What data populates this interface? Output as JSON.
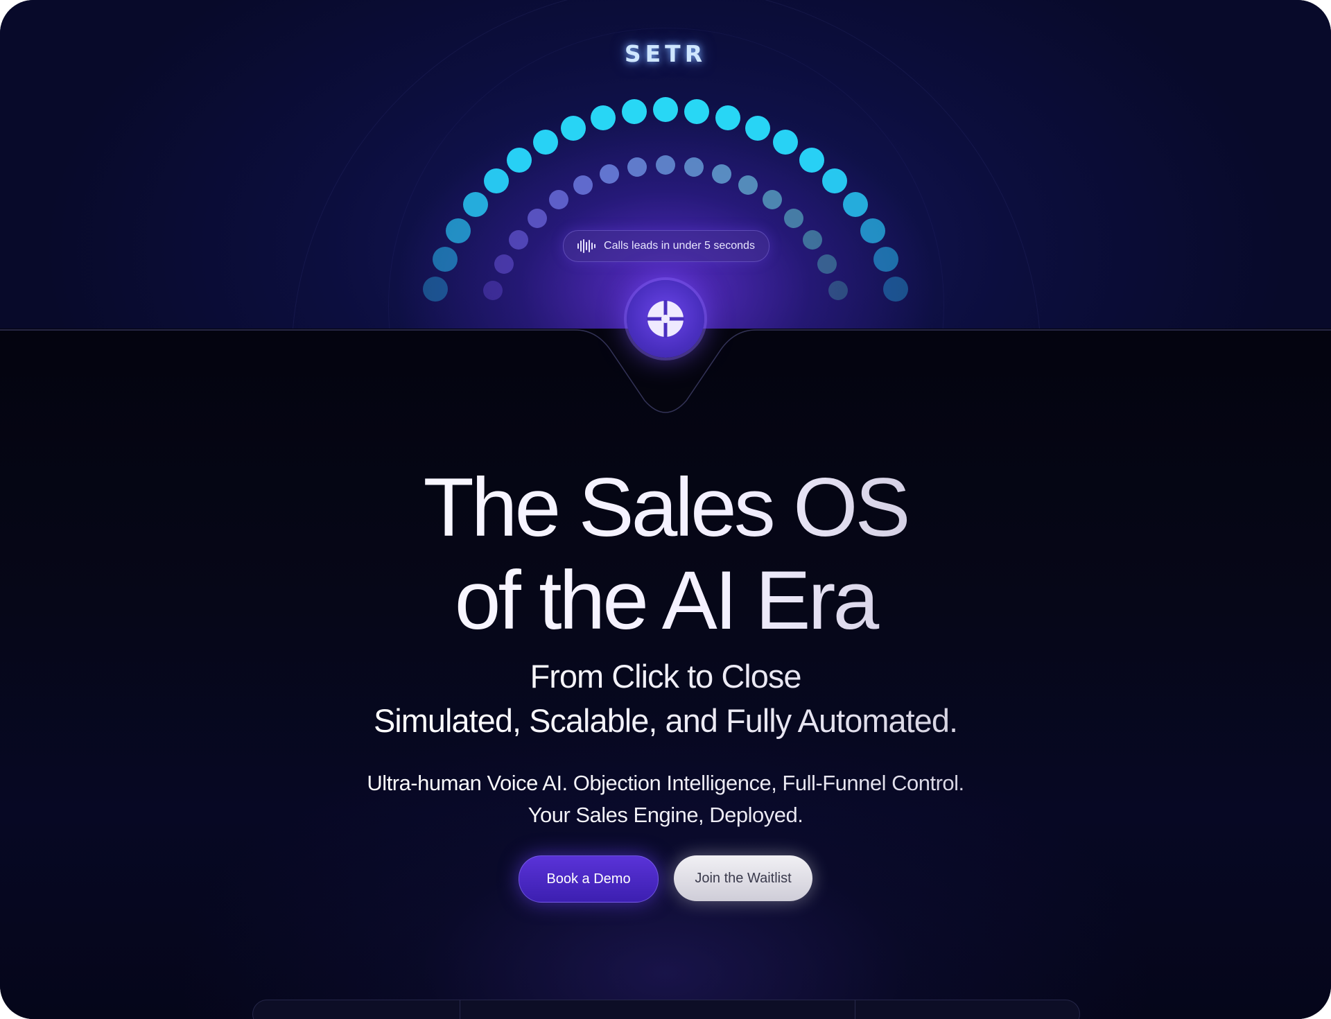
{
  "brand": {
    "logo": "SETR"
  },
  "hero_badge": {
    "icon": "soundwave-icon",
    "text": "Calls leads in under 5 seconds"
  },
  "center_icon": "crosshair-orb-icon",
  "headline": {
    "line1": "The Sales OS",
    "line2": "of the AI Era"
  },
  "subheadline": {
    "line1": "From Click to Close",
    "line2": "Simulated, Scalable, and Fully Automated."
  },
  "description": {
    "line1": "Ultra-human Voice AI. Objection Intelligence, Full-Funnel Control.",
    "line2": "Your Sales Engine, Deployed."
  },
  "cta": {
    "primary": "Book a Demo",
    "secondary": "Join the Waitlist"
  },
  "colors": {
    "accent": "#5a33d8",
    "dot_outer": "#28d7f5",
    "dot_inner": "#7b5cf0",
    "background": "#05061a"
  }
}
